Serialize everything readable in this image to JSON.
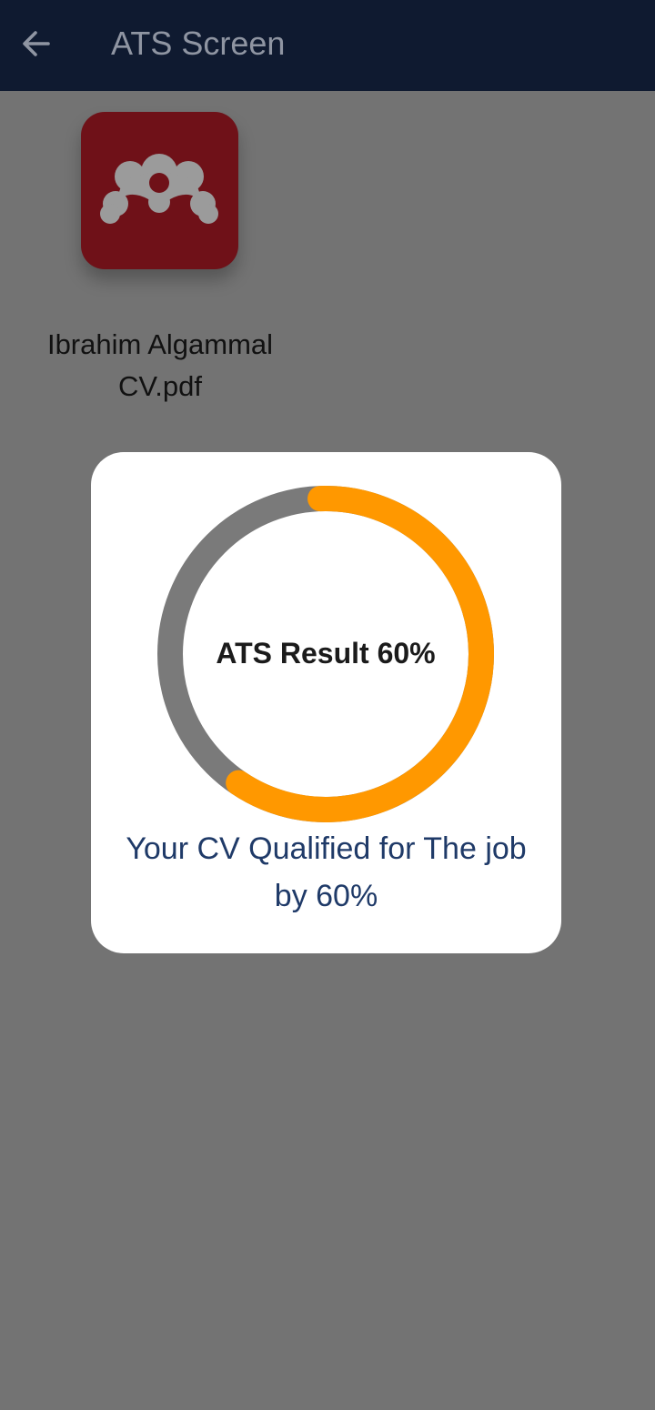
{
  "app_bar": {
    "title": "ATS Screen",
    "back_icon": "arrow-left-icon",
    "background": "#0f1a30"
  },
  "file": {
    "name": "Ibrahim Algammal CV.pdf",
    "icon": "mendeley-logo-icon",
    "icon_color": "#6f1118"
  },
  "ats_dialog": {
    "progress_label": "ATS Result 60%",
    "progress_fraction": 0.6,
    "progress_color": "#ff9800",
    "track_color": "#7a7a7a",
    "message": "Your CV Qualified for The job by 60%"
  }
}
